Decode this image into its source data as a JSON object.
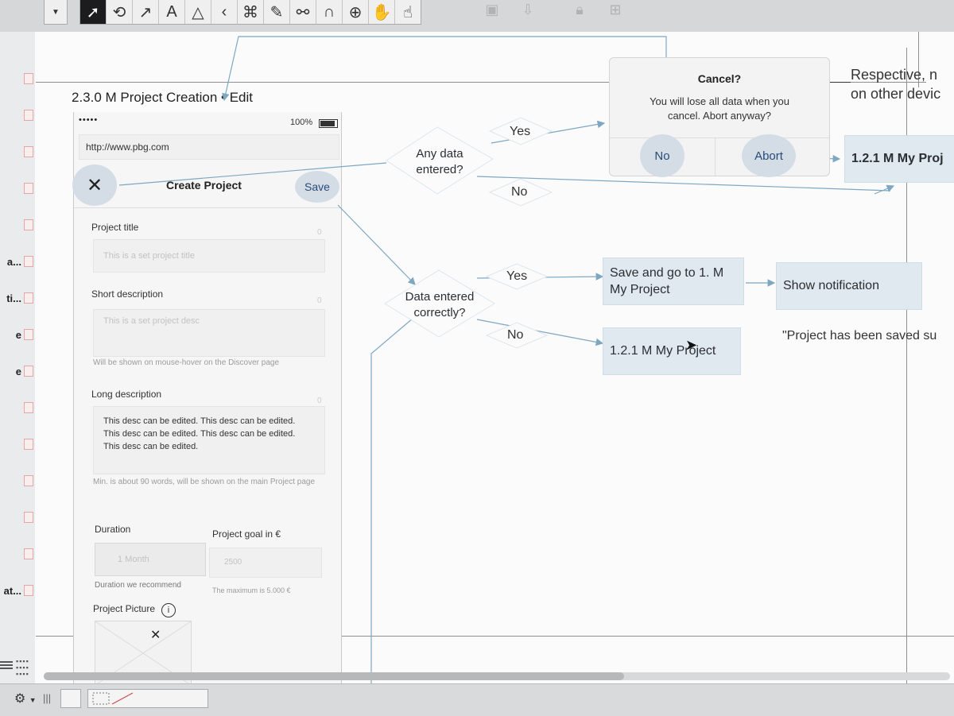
{
  "toolbar": {
    "tools": [
      {
        "name": "pointer-tool-icon",
        "glyph": "➚",
        "active": true
      },
      {
        "name": "lasso-tool-icon",
        "glyph": "⟲"
      },
      {
        "name": "line-tool-icon",
        "glyph": "↗"
      },
      {
        "name": "text-tool-icon",
        "glyph": "A"
      },
      {
        "name": "shape-tool-icon",
        "glyph": "△"
      },
      {
        "name": "back-tool-icon",
        "glyph": "‹"
      },
      {
        "name": "diagram-tool-icon",
        "glyph": "⌘"
      },
      {
        "name": "style-tool-icon",
        "glyph": "✎"
      },
      {
        "name": "magnet-tool-icon",
        "glyph": "⚯"
      },
      {
        "name": "arch-tool-icon",
        "glyph": "∩"
      },
      {
        "name": "zoom-tool-icon",
        "glyph": "⊕"
      },
      {
        "name": "hand-tool-icon",
        "glyph": "✋"
      },
      {
        "name": "browse-tool-icon",
        "glyph": "☝"
      }
    ]
  },
  "left_panel": {
    "items": [
      {
        "label": ""
      },
      {
        "label": ""
      },
      {
        "label": ""
      },
      {
        "label": ""
      },
      {
        "label": ""
      },
      {
        "label": "a..."
      },
      {
        "label": "ti..."
      },
      {
        "label": "e"
      },
      {
        "label": "e"
      },
      {
        "label": ""
      },
      {
        "label": ""
      },
      {
        "label": ""
      },
      {
        "label": ""
      },
      {
        "label": ""
      },
      {
        "label": "at..."
      }
    ]
  },
  "page_title": "2.3.0 M Project Creation • Edit",
  "phone": {
    "signal": "•••••",
    "battery": "100%",
    "url": "http://www.pbg.com",
    "nav_title": "Create Project",
    "save_label": "Save",
    "close_glyph": "✕",
    "project_title_label": "Project title",
    "project_title_placeholder": "This is a set project title",
    "short_desc_label": "Short description",
    "short_desc_placeholder": "This is a set project desc",
    "short_desc_hint": "Will be shown on mouse-hover on the Discover page",
    "long_desc_label": "Long description",
    "long_desc_text": "This desc can be edited. This desc can be edited. This desc can be edited. This desc can be edited. This desc can be edited.",
    "long_desc_hint": "Min. is about 90 words, will be shown on the main Project page",
    "counter": "0",
    "duration_label": "Duration",
    "duration_value": "1 Month",
    "duration_hint": "Duration we recommend",
    "goal_label": "Project goal in €",
    "goal_value": "2500",
    "goal_hint": "The maximum is 5.000 €",
    "picture_label": "Project Picture",
    "info_glyph": "i",
    "picture_close": "✕"
  },
  "flow": {
    "any_data": "Any data entered?",
    "yes1": "Yes",
    "no1": "No",
    "data_correct": "Data entered correctly?",
    "yes2": "Yes",
    "no2": "No",
    "save_go": "Save and go to 1. M My Project",
    "show_notification": "Show notification",
    "my_project_2": "1.2.1 M My Project",
    "my_project_1": "1.2.1 M My Proj",
    "notification_text": "\"Project has been saved su",
    "respective": "Respective, n",
    "other_devices": "on other devic"
  },
  "dialog": {
    "title": "Cancel?",
    "message": "You will lose all data when you cancel. Abort anyway?",
    "no_label": "No",
    "abort_label": "Abort"
  },
  "bottom": {
    "gear_glyph": "⚙",
    "bars_glyph": "|||"
  },
  "colors": {
    "connector": "#7ea7c2",
    "box": "#dfe9ef",
    "dialog_button": "#274b78"
  }
}
